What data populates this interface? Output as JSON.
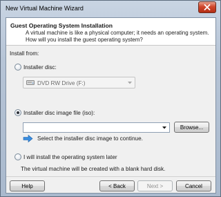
{
  "window": {
    "title": "New Virtual Machine Wizard",
    "close_icon": "close-x-icon"
  },
  "header": {
    "title": "Guest Operating System Installation",
    "subtitle": "A virtual machine is like a physical computer; it needs an operating system. How will you install the guest operating system?"
  },
  "install_from": {
    "label": "Install from:"
  },
  "options": {
    "installer_disc": {
      "label": "Installer disc:",
      "selected": false,
      "drive": {
        "value": "DVD RW Drive (F:)",
        "icon": "dvd-drive-icon"
      }
    },
    "iso": {
      "label": "Installer disc image file (iso):",
      "selected": true,
      "value": "",
      "browse_label": "Browse...",
      "hint_icon": "info-arrow-icon",
      "hint": "Select the installer disc image to continue."
    },
    "later": {
      "label": "I will install the operating system later",
      "selected": false,
      "description": "The virtual machine will be created with a blank hard disk."
    }
  },
  "footer": {
    "help_label": "Help",
    "back_label": "< Back",
    "next_label": "Next >",
    "cancel_label": "Cancel"
  },
  "colors": {
    "accent": "#2b7ccf",
    "close_red": "#c23a1e"
  }
}
